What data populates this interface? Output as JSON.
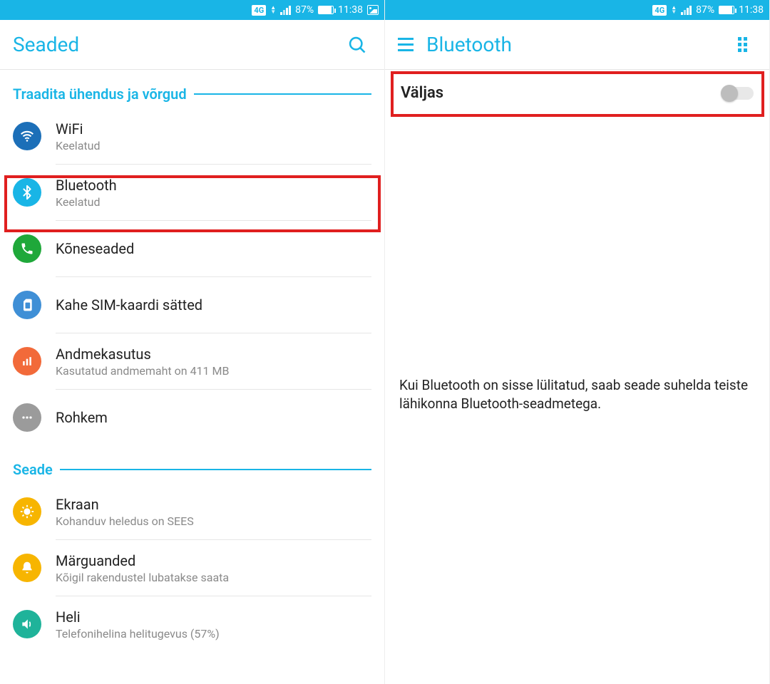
{
  "status": {
    "network": "4G",
    "battery_pct": "87%",
    "time": "11:38"
  },
  "left": {
    "title": "Seaded",
    "section1": "Traadita ühendus ja võrgud",
    "section2": "Seade",
    "items": {
      "wifi": {
        "title": "WiFi",
        "sub": "Keelatud"
      },
      "bluetooth": {
        "title": "Bluetooth",
        "sub": "Keelatud"
      },
      "call": {
        "title": "Kõneseaded"
      },
      "dualsim": {
        "title": "Kahe SIM-kaardi sätted"
      },
      "data": {
        "title": "Andmekasutus",
        "sub": "Kasutatud andmemaht on 411 MB"
      },
      "more": {
        "title": "Rohkem"
      },
      "display": {
        "title": "Ekraan",
        "sub": "Kohanduv heledus on SEES"
      },
      "notif": {
        "title": "Märguanded",
        "sub": "Kõigil rakendustel lubatakse saata"
      },
      "sound": {
        "title": "Heli",
        "sub": "Telefonihelina helitugevus (57%)"
      }
    }
  },
  "right": {
    "title": "Bluetooth",
    "toggle_label": "Väljas",
    "info": "Kui Bluetooth on sisse lülitatud, saab seade suhelda teiste lähikonna Bluetooth-seadmetega."
  }
}
